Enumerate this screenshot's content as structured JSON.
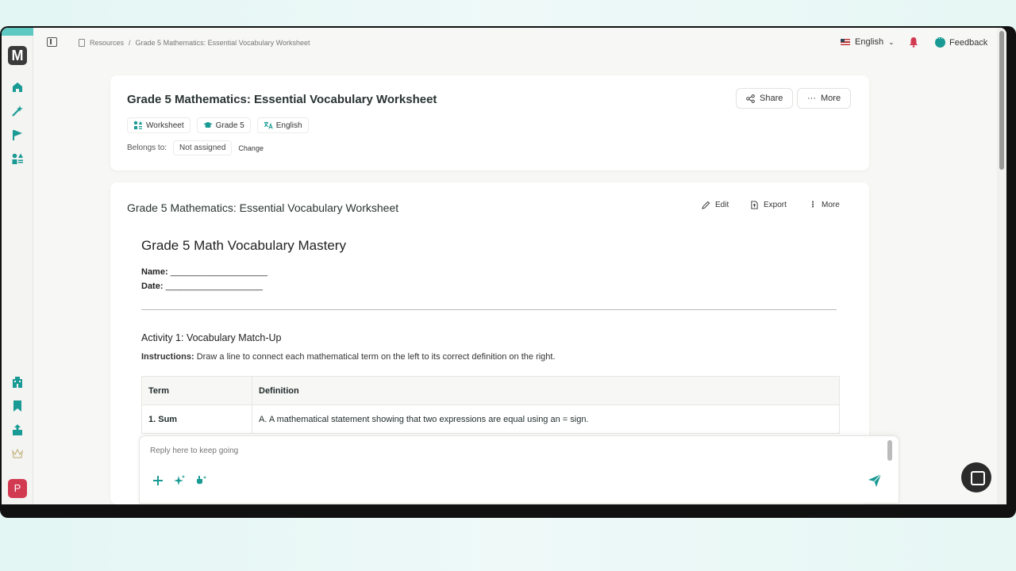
{
  "breadcrumb": {
    "root": "Resources",
    "separator": "/",
    "current": "Grade 5 Mathematics: Essential Vocabulary Worksheet"
  },
  "topbar": {
    "language": "English",
    "feedback": "Feedback"
  },
  "sidebar": {
    "logo": "M",
    "avatar": "P"
  },
  "header_card": {
    "title": "Grade 5 Mathematics: Essential Vocabulary Worksheet",
    "share": "Share",
    "more": "More",
    "tags": [
      "Worksheet",
      "Grade 5",
      "English"
    ],
    "belongs_label": "Belongs to:",
    "belongs_value": "Not assigned",
    "change": "Change"
  },
  "content_card": {
    "title": "Grade 5 Mathematics: Essential Vocabulary Worksheet",
    "edit": "Edit",
    "export": "Export",
    "more": "More"
  },
  "document": {
    "heading": "Grade 5 Math Vocabulary Mastery",
    "name_label": "Name:",
    "name_blank": "____________________",
    "date_label": "Date:",
    "date_blank": "____________________",
    "activity_title": "Activity 1: Vocabulary Match-Up",
    "instructions_label": "Instructions:",
    "instructions_text": "Draw a line to connect each mathematical term on the left to its correct definition on the right.",
    "table": {
      "headers": [
        "Term",
        "Definition"
      ],
      "rows": [
        [
          "1. Sum",
          "A. A mathematical statement showing that two expressions are equal using an = sign."
        ]
      ]
    }
  },
  "reply": {
    "placeholder": "Reply here to keep going"
  },
  "colors": {
    "accent": "#1a9a94",
    "alert": "#d23a52"
  }
}
